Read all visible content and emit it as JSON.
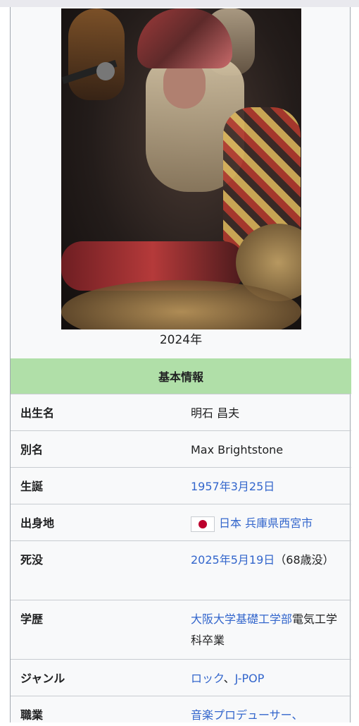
{
  "photo_caption": "2024年",
  "infobox_header": "基本情報",
  "rows": [
    {
      "label": "出生名",
      "value": "明石 昌夫"
    },
    {
      "label": "別名",
      "value": "Max Brightstone"
    },
    {
      "label": "生誕",
      "value": "1957年3月25日"
    },
    {
      "label": "出身地",
      "country": "日本",
      "place": "兵庫県西宮市",
      "flag_icon": "japan-flag-icon"
    },
    {
      "label": "死没",
      "date": "2025年5月19日",
      "age": "（68歳没）"
    },
    {
      "label": "学歴",
      "school": "大阪大学基礎工学部",
      "dept": "電気工学科卒業"
    },
    {
      "label": "ジャンル",
      "genre1": "ロック",
      "sep": "、",
      "genre2": "J-POP"
    },
    {
      "label": "職業",
      "value": "音楽プロデューサー、"
    }
  ],
  "colors": {
    "header_bg": "#b0dfa8",
    "link": "#3366cc",
    "infobox_bg": "#f8f9fa"
  }
}
